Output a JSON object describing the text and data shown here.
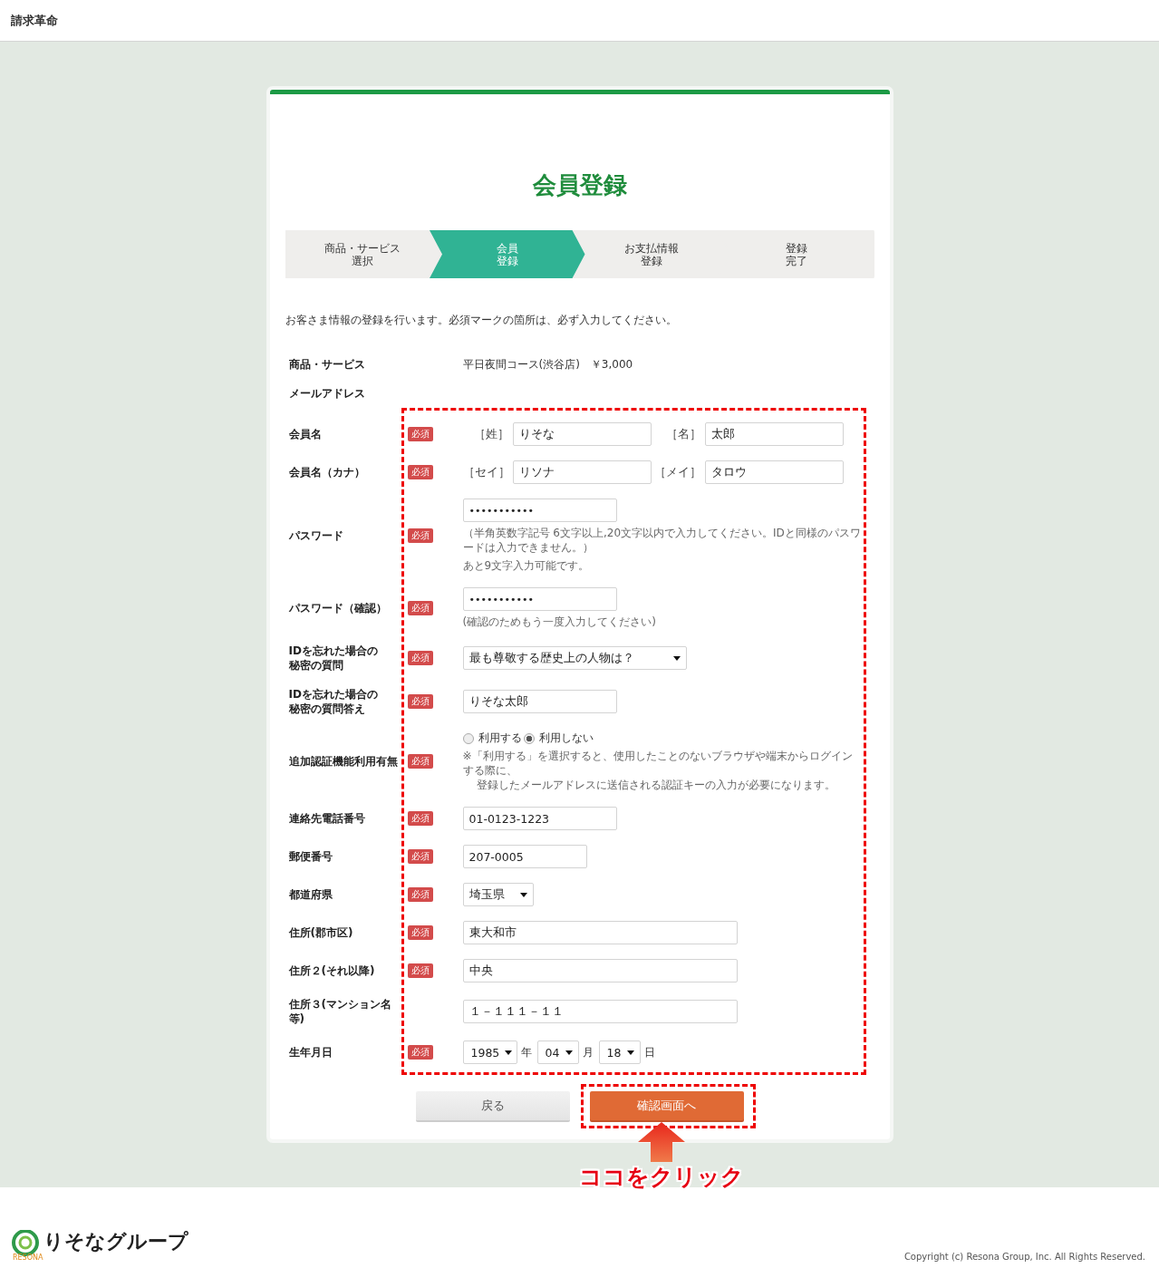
{
  "header": {
    "title": "請求革命"
  },
  "form_title": "会員登録",
  "steps": [
    {
      "lines": [
        "商品・サービス",
        "選択"
      ],
      "selected": false
    },
    {
      "lines": [
        "会員",
        "登録"
      ],
      "selected": true
    },
    {
      "lines": [
        "お支払情報",
        "登録"
      ],
      "selected": false
    },
    {
      "lines": [
        "登録",
        "完了"
      ],
      "selected": false
    }
  ],
  "intro": "お客さま情報の登録を行います。必須マークの箇所は、必ず入力してください。",
  "plain_rows": [
    {
      "kind": "text",
      "label": [
        "商品・サービス"
      ],
      "value": "平日夜間コース(渋谷店)　￥3,000"
    },
    {
      "kind": "empty",
      "label": [
        "メールアドレス"
      ]
    }
  ],
  "rows": [
    {
      "kind": "pair",
      "label": [
        "会員名"
      ],
      "badge": "必須",
      "fields": [
        {
          "prefix": "［姓］",
          "value": "りそな"
        },
        {
          "prefix": "［名］",
          "value": "太郎"
        }
      ]
    },
    {
      "kind": "pair",
      "label": [
        "会員名（カナ）"
      ],
      "badge": "必須",
      "fields": [
        {
          "prefix": "［セイ］",
          "value": "リソナ"
        },
        {
          "prefix": "［メイ］",
          "value": "タロウ"
        }
      ]
    },
    {
      "kind": "input",
      "label": [
        "パスワード"
      ],
      "badge": "必須",
      "value": "•••••••••••",
      "notes": [
        "（半角英数字記号 6文字以上,20文字以内で入力してください。IDと同様のパスワードは入力できません。）",
        "あと9文字入力可能です。"
      ]
    },
    {
      "kind": "input",
      "label": [
        "パスワード（確認）"
      ],
      "badge": "必須",
      "value": "•••••••••••",
      "notes": [
        "(確認のためもう一度入力してください)"
      ]
    },
    {
      "kind": "select",
      "label": [
        "IDを忘れた場合の",
        "秘密の質問"
      ],
      "badge": "必須",
      "value": "最も尊敬する歴史上の人物は？"
    },
    {
      "kind": "input",
      "label": [
        "IDを忘れた場合の",
        "秘密の質問答え"
      ],
      "badge": "必須",
      "value": "りそな太郎"
    },
    {
      "kind": "radio",
      "label": [
        "追加認証機能利用有無"
      ],
      "badge": "必須",
      "options": [
        {
          "label": "利用する",
          "selected": false
        },
        {
          "label": "利用しない",
          "selected": true
        }
      ],
      "notes": [
        "※「利用する」を選択すると、使用したことのないブラウザや端末からログインする際に、",
        "登録したメールアドレスに送信される認証キーの入力が必要になります。"
      ]
    },
    {
      "kind": "input",
      "label": [
        "連絡先電話番号"
      ],
      "badge": "必須",
      "value": "01-0123-1223"
    },
    {
      "kind": "input",
      "label": [
        "郵便番号"
      ],
      "badge": "必須",
      "value": "207-0005"
    },
    {
      "kind": "select",
      "label": [
        "都道府県"
      ],
      "badge": "必須",
      "value": "埼玉県"
    },
    {
      "kind": "input",
      "label": [
        "住所(郡市区)"
      ],
      "badge": "必須",
      "value": "東大和市"
    },
    {
      "kind": "input",
      "label": [
        "住所２(それ以降)"
      ],
      "badge": "必須",
      "value": "中央"
    },
    {
      "kind": "input",
      "label": [
        "住所３(マンション名",
        "等)"
      ],
      "value": "１－１１１－１１"
    },
    {
      "kind": "date",
      "label": [
        "生年月日"
      ],
      "badge": "必須",
      "parts": [
        {
          "value": "1985",
          "unit": "年"
        },
        {
          "value": "04",
          "unit": "月"
        },
        {
          "value": "18",
          "unit": "日"
        }
      ]
    }
  ],
  "buttons": {
    "back": "戻る",
    "next": "確認画面へ"
  },
  "callout": "ココをクリック",
  "footer": {
    "logo": "りそなグループ",
    "logo_sub": "RESONA",
    "copyright": "Copyright (c) Resona Group, Inc. All Rights Reserved."
  }
}
